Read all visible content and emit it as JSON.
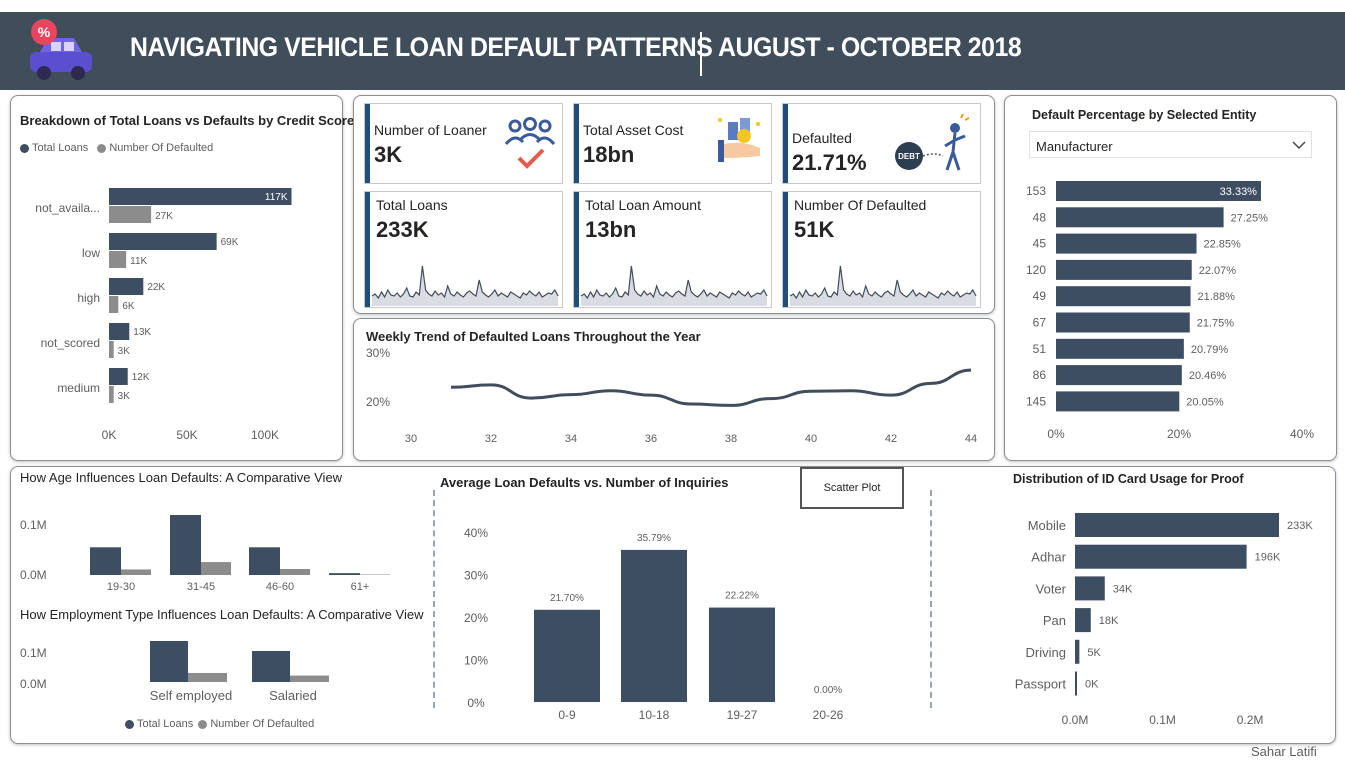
{
  "header": {
    "title": "NAVIGATING VEHICLE LOAN DEFAULT PATTERNS",
    "period": "AUGUST - OCTOBER 2018",
    "logo_badge": "%"
  },
  "credit_score": {
    "title": "Breakdown of Total Loans vs Defaults by Credit Score",
    "legend": [
      "Total Loans",
      "Number Of Defaulted"
    ],
    "categories": [
      "not_availa...",
      "low",
      "high",
      "not_scored",
      "medium"
    ],
    "total_labels": [
      "117K",
      "69K",
      "22K",
      "13K",
      "12K"
    ],
    "default_labels": [
      "27K",
      "11K",
      "6K",
      "3K",
      "3K"
    ],
    "x_ticks": [
      "0K",
      "50K",
      "100K"
    ]
  },
  "kpis": {
    "loaner": {
      "label": "Number of Loaner",
      "value": "3K"
    },
    "asset": {
      "label": "Total Asset Cost",
      "value": "18bn"
    },
    "defaulted": {
      "label": "Defaulted",
      "value": "21.71%",
      "badge": "DEBT"
    },
    "total_loans": {
      "label": "Total Loans",
      "value": "233K"
    },
    "loan_amount": {
      "label": "Total Loan Amount",
      "value": "13bn"
    },
    "num_defaulted": {
      "label": "Number Of Defaulted",
      "value": "51K"
    }
  },
  "weekly": {
    "title": "Weekly Trend of Defaulted Loans Throughout the Year",
    "y_ticks": [
      "30%",
      "20%"
    ],
    "x_ticks": [
      "30",
      "32",
      "34",
      "36",
      "38",
      "40",
      "42",
      "44"
    ]
  },
  "entity": {
    "title": "Default Percentage by Selected Entity",
    "dropdown": "Manufacturer",
    "categories": [
      "153",
      "48",
      "45",
      "120",
      "49",
      "67",
      "51",
      "86",
      "145"
    ],
    "labels": [
      "33.33%",
      "27.25%",
      "22.85%",
      "22.07%",
      "21.88%",
      "21.75%",
      "20.79%",
      "20.46%",
      "20.05%"
    ],
    "x_ticks": [
      "0%",
      "20%",
      "40%"
    ]
  },
  "age": {
    "title": "How Age Influences Loan Defaults: A Comparative View",
    "y_ticks": [
      "0.1M",
      "0.0M"
    ],
    "categories": [
      "19-30",
      "31-45",
      "46-60",
      "61+"
    ]
  },
  "employment": {
    "title": "How Employment Type Influences Loan Defaults: A Comparative View",
    "y_ticks": [
      "0.1M",
      "0.0M"
    ],
    "categories": [
      "Self employed",
      "Salaried"
    ],
    "legend": [
      "Total Loans",
      "Number Of Defaulted"
    ]
  },
  "inquiries": {
    "title": "Average Loan Defaults vs. Number of Inquiries",
    "button": "Scatter Plot",
    "y_ticks": [
      "40%",
      "30%",
      "20%",
      "10%",
      "0%"
    ],
    "categories": [
      "0-9",
      "10-18",
      "19-27",
      "20-26"
    ],
    "labels": [
      "21.70%",
      "35.79%",
      "22.22%",
      "0.00%"
    ]
  },
  "idcard": {
    "title": "Distribution of ID Card Usage for Proof",
    "categories": [
      "Mobile",
      "Adhar",
      "Voter",
      "Pan",
      "Driving",
      "Passport"
    ],
    "labels": [
      "233K",
      "196K",
      "34K",
      "18K",
      "5K",
      "0K"
    ],
    "x_ticks": [
      "0.0M",
      "0.1M",
      "0.2M"
    ]
  },
  "footer": {
    "author": "Sahar Latifi"
  },
  "colors": {
    "header": "#404d5b",
    "dark": "#3e4e62",
    "gray": "#8c8c8c",
    "accent": "#1f4e79"
  },
  "chart_data": [
    {
      "type": "bar",
      "title": "Breakdown of Total Loans vs Defaults by Credit Score",
      "categories": [
        "not_availa...",
        "low",
        "high",
        "not_scored",
        "medium"
      ],
      "series": [
        {
          "name": "Total Loans",
          "values": [
            117000,
            69000,
            22000,
            13000,
            12000
          ]
        },
        {
          "name": "Number Of Defaulted",
          "values": [
            27000,
            11000,
            6000,
            3000,
            3000
          ]
        }
      ],
      "xlim": [
        0,
        120000
      ]
    },
    {
      "type": "line",
      "title": "Weekly Trend of Defaulted Loans Throughout the Year",
      "x": [
        31,
        32,
        33,
        34,
        35,
        36,
        37,
        38,
        39,
        40,
        41,
        42,
        43,
        44
      ],
      "values": [
        23.0,
        23.5,
        20.8,
        21.5,
        22.3,
        21.4,
        19.6,
        19.3,
        20.7,
        22.2,
        22.3,
        21.4,
        23.8,
        26.5
      ],
      "ylim": [
        16,
        32
      ]
    },
    {
      "type": "bar",
      "title": "Default Percentage by Selected Entity",
      "categories": [
        "153",
        "48",
        "45",
        "120",
        "49",
        "67",
        "51",
        "86",
        "145"
      ],
      "values": [
        33.33,
        27.25,
        22.85,
        22.07,
        21.88,
        21.75,
        20.79,
        20.46,
        20.05
      ],
      "xlim": [
        0,
        40
      ]
    },
    {
      "type": "bar",
      "title": "How Age Influences Loan Defaults: A Comparative View",
      "categories": [
        "19-30",
        "31-45",
        "46-60",
        "61+"
      ],
      "series": [
        {
          "name": "Total Loans",
          "values": [
            60000,
            130000,
            60000,
            4000
          ]
        },
        {
          "name": "Number Of Defaulted",
          "values": [
            12000,
            28000,
            13000,
            1000
          ]
        }
      ],
      "ylim": [
        0,
        130000
      ]
    },
    {
      "type": "bar",
      "title": "How Employment Type Influences Loan Defaults: A Comparative View",
      "categories": [
        "Self employed",
        "Salaried"
      ],
      "series": [
        {
          "name": "Total Loans",
          "values": [
            127000,
            96000
          ]
        },
        {
          "name": "Number Of Defaulted",
          "values": [
            28000,
            20000
          ]
        }
      ],
      "ylim": [
        0,
        130000
      ]
    },
    {
      "type": "bar",
      "title": "Average Loan Defaults vs. Number of Inquiries",
      "categories": [
        "0-9",
        "10-18",
        "19-27",
        "20-26"
      ],
      "values": [
        21.7,
        35.79,
        22.22,
        0.0
      ],
      "ylim": [
        0,
        40
      ]
    },
    {
      "type": "bar",
      "title": "Distribution of ID Card Usage for Proof",
      "categories": [
        "Mobile",
        "Adhar",
        "Voter",
        "Pan",
        "Driving",
        "Passport"
      ],
      "values": [
        233000,
        196000,
        34000,
        18000,
        5000,
        0
      ],
      "xlim": [
        0,
        250000
      ]
    }
  ]
}
